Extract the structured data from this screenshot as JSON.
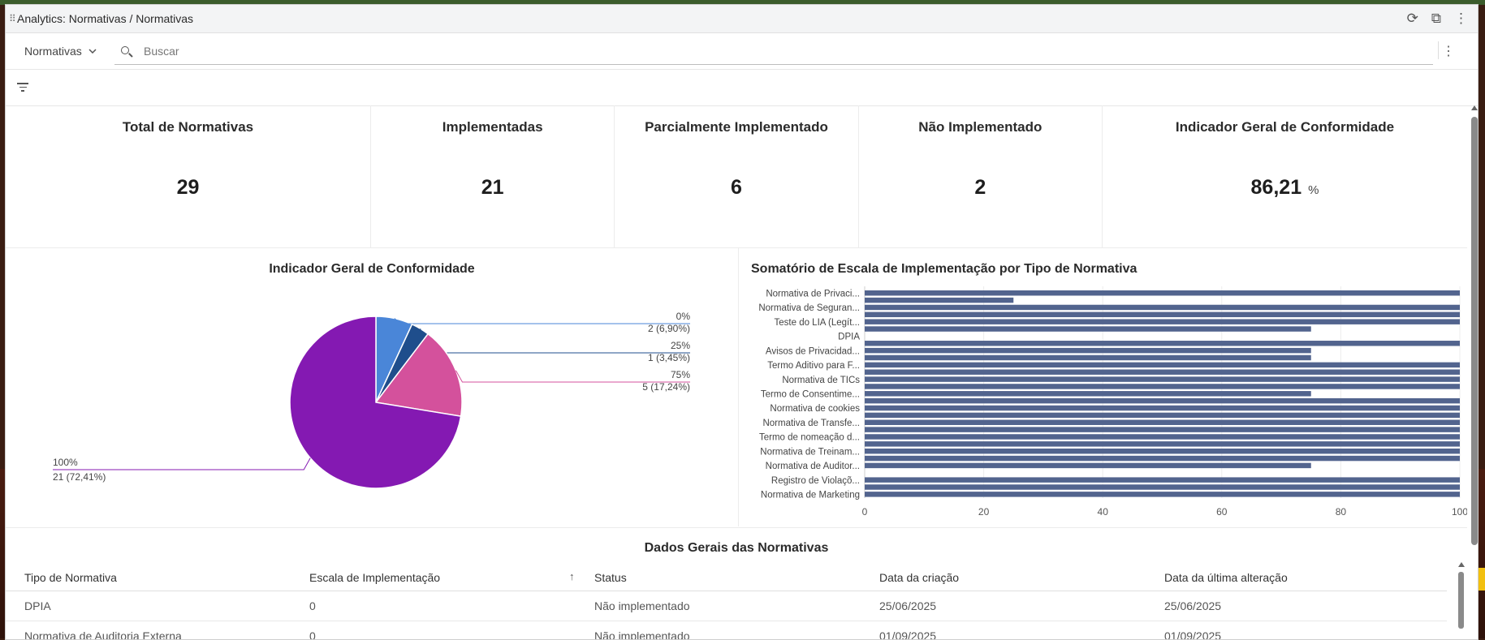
{
  "window": {
    "title": "Analytics: Normativas / Normativas"
  },
  "toolbar": {
    "dropdown_label": "Normativas",
    "search_placeholder": "Buscar"
  },
  "kpis": [
    {
      "title": "Total de Normativas",
      "value": "29",
      "unit": ""
    },
    {
      "title": "Implementadas",
      "value": "21",
      "unit": ""
    },
    {
      "title": "Parcialmente Implementado",
      "value": "6",
      "unit": ""
    },
    {
      "title": "Não Implementado",
      "value": "2",
      "unit": ""
    },
    {
      "title": "Indicador Geral de Conformidade",
      "value": "86,21",
      "unit": "%"
    }
  ],
  "pie_chart": {
    "title": "Indicador Geral de Conformidade",
    "slices": [
      {
        "label": "0%",
        "value_label": "2 (6,90%)",
        "value": 2,
        "color": "#4a86d8"
      },
      {
        "label": "25%",
        "value_label": "1 (3,45%)",
        "value": 1,
        "color": "#1f4e8c"
      },
      {
        "label": "75%",
        "value_label": "5 (17,24%)",
        "value": 5,
        "color": "#d4519c"
      },
      {
        "label": "100%",
        "value_label": "21 (72,41%)",
        "value": 21,
        "color": "#8419b2"
      }
    ]
  },
  "bar_chart": {
    "title": "Somatório de Escala de Implementação por Tipo de Normativa",
    "bar_color": "#52648e",
    "x_ticks": [
      "0",
      "20",
      "40",
      "60",
      "80",
      "100"
    ],
    "y_labels": [
      "Normativa de Privaci...",
      "Normativa de Seguran...",
      "Teste do LIA (Legít...",
      "DPIA",
      "Avisos de Privacidad...",
      "Termo Aditivo para F...",
      "Normativa de TICs",
      "Termo de Consentime...",
      "Normativa de cookies",
      "Normativa de Transfe...",
      "Termo de nomeação d...",
      "Normativa de Treinam...",
      "Normativa de Auditor...",
      "Registro de Violaçõ...",
      "Normativa de Marketing"
    ]
  },
  "chart_data": [
    {
      "type": "pie",
      "title": "Indicador Geral de Conformidade",
      "categories": [
        "0%",
        "25%",
        "75%",
        "100%"
      ],
      "values": [
        2,
        1,
        5,
        21
      ],
      "labels": [
        "2 (6,90%)",
        "1 (3,45%)",
        "5 (17,24%)",
        "21 (72,41%)"
      ]
    },
    {
      "type": "bar",
      "orientation": "horizontal",
      "title": "Somatório de Escala de Implementação por Tipo de Normativa",
      "xlim": [
        0,
        100
      ],
      "values": [
        100,
        25,
        100,
        100,
        100,
        75,
        0,
        100,
        75,
        75,
        100,
        100,
        100,
        100,
        75,
        100,
        100,
        100,
        100,
        100,
        100,
        100,
        100,
        100,
        75,
        0,
        100,
        100,
        100
      ]
    }
  ],
  "table": {
    "title": "Dados Gerais das Normativas",
    "columns": [
      "Tipo de Normativa",
      "Escala de Implementação",
      "Status",
      "Data da criação",
      "Data da última alteração"
    ],
    "sort_arrow": "↑",
    "rows": [
      [
        "DPIA",
        "0",
        "Não implementado",
        "25/06/2025",
        "25/06/2025"
      ],
      [
        "Normativa de Auditoria Externa",
        "0",
        "Não implementado",
        "01/09/2025",
        "01/09/2025"
      ]
    ]
  }
}
